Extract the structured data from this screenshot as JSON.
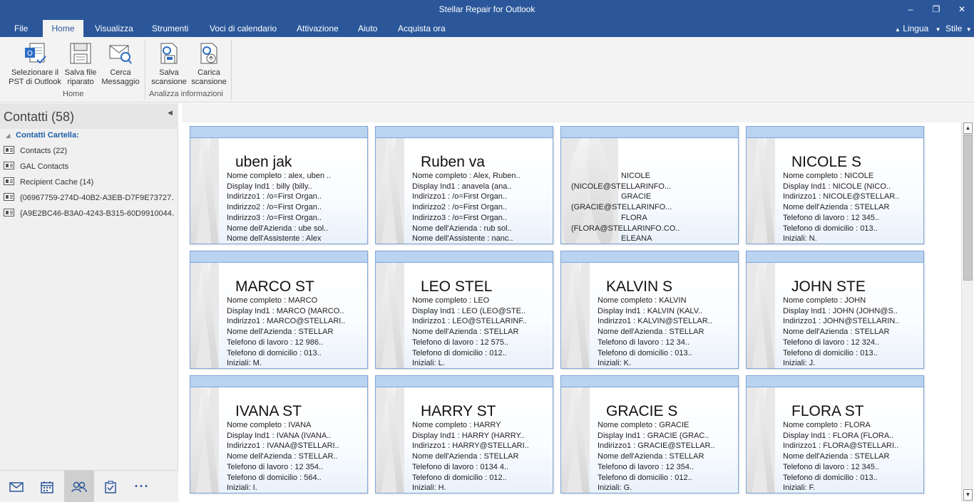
{
  "window": {
    "title": "Stellar Repair for Outlook",
    "controls": [
      "–",
      "❐",
      "✕"
    ]
  },
  "menu": {
    "tabs": [
      "File",
      "Home",
      "Visualizza",
      "Strumenti",
      "Voci di calendario",
      "Attivazione",
      "Aiuto",
      "Acquista ora"
    ],
    "active": "Home",
    "right": {
      "language": "Lingua",
      "style": "Stile"
    }
  },
  "ribbon": {
    "buttons": {
      "select_pst": "Selezionare il PST di Outlook",
      "save_repaired": "Salva file riparato",
      "find_message": "Cerca Messaggio",
      "save_scan": "Salva scansione",
      "load_scan": "Carica scansione"
    },
    "groups": {
      "home": "Home",
      "analyze": "Analizza informazioni"
    }
  },
  "sidebar": {
    "title": "Contatti (58)",
    "root_label": "Contatti Cartella:",
    "folders": [
      "Contacts (22)",
      "GAL Contacts",
      "Recipient Cache (14)",
      "{06967759-274D-40B2-A3EB-D7F9E73727…",
      "{A9E2BC46-B3A0-4243-B315-60D9910044…"
    ],
    "nav_icons": [
      "mail-icon",
      "calendar-icon",
      "contacts-icon",
      "tasks-icon",
      "more-icon"
    ]
  },
  "cards": [
    {
      "name": "uben jak",
      "fields": [
        "Nome completo : alex, uben ..",
        "Display Ind1 : billy (billy..",
        "Indirizzo1 : /o=First Organ..",
        "Indirizzo2 : /o=First Organ..",
        "Indirizzo3 : /o=First Organ..",
        "Nome dell'Azienda : ube sol..",
        "Nome dell'Assistente : Alex"
      ]
    },
    {
      "name": "Ruben va",
      "fields": [
        "Nome completo : Alex, Ruben..",
        "Display Ind1 : anavela (ana..",
        "Indirizzo1 : /o=First Organ..",
        "Indirizzo2 : /o=First Organ..",
        "Indirizzo3 : /o=First Organ..",
        "Nome dell'Azienda : rub sol..",
        "Nome dell'Assistente : nanc.."
      ]
    },
    {
      "name": "",
      "fields": [
        "NICOLE",
        "(NICOLE@STELLARINFO...",
        "GRACIE",
        "(GRACIE@STELLARINFO...",
        "FLORA",
        "(FLORA@STELLARINFO.CO..",
        "ELEANA"
      ]
    },
    {
      "name": "NICOLE S",
      "fields": [
        "Nome completo : NICOLE",
        "Display Ind1 : NICOLE (NICO..",
        "Indirizzo1 : NICOLE@STELLAR..",
        "Nome dell'Azienda : STELLAR",
        "Telefono di lavoro : 12 345..",
        "Telefono di domicilio : 013..",
        "Iniziali: N."
      ]
    },
    {
      "name": "MARCO ST",
      "fields": [
        "Nome completo : MARCO",
        "Display Ind1 : MARCO (MARCO..",
        "Indirizzo1 : MARCO@STELLARI..",
        "Nome dell'Azienda : STELLAR",
        "Telefono di lavoro : 12 986..",
        "Telefono di domicilio : 013..",
        "Iniziali: M."
      ]
    },
    {
      "name": "LEO STEL",
      "fields": [
        "Nome completo : LEO",
        "Display Ind1 : LEO (LEO@STE..",
        "Indirizzo1 : LEO@STELLARINF..",
        "Nome dell'Azienda : STELLAR",
        "Telefono di lavoro : 12 575..",
        "Telefono di domicilio : 012..",
        "Iniziali: L."
      ]
    },
    {
      "name": "KALVIN S",
      "fields": [
        "Nome completo : KALVIN",
        "Display Ind1 : KALVIN (KALV..",
        "Indirizzo1 : KALVIN@STELLAR..",
        "Nome dell'Azienda : STELLAR",
        "Telefono di lavoro : 12 34..",
        "Telefono di domicilio : 013..",
        "Iniziali: K."
      ]
    },
    {
      "name": "JOHN STE",
      "fields": [
        "Nome completo : JOHN",
        "Display Ind1 : JOHN (JOHN@S..",
        "Indirizzo1 : JOHN@STELLARIN..",
        "Nome dell'Azienda : STELLAR",
        "Telefono di lavoro : 12 324..",
        "Telefono di domicilio : 013..",
        "Iniziali: J."
      ]
    },
    {
      "name": "IVANA ST",
      "fields": [
        "Nome completo : IVANA",
        "Display Ind1 : IVANA (IVANA..",
        "Indirizzo1 : IVANA@STELLARI..",
        "Nome dell'Azienda : STELLAR..",
        "Telefono di lavoro : 12 354..",
        "Telefono di domicilio : 564..",
        "Iniziali: I."
      ]
    },
    {
      "name": "HARRY ST",
      "fields": [
        "Nome completo : HARRY",
        "Display Ind1 : HARRY (HARRY..",
        "Indirizzo1 : HARRY@STELLARI..",
        "Nome dell'Azienda : STELLAR",
        "Telefono di lavoro : 0134 4..",
        "Telefono di domicilio : 012..",
        "Iniziali: H."
      ]
    },
    {
      "name": "GRACIE S",
      "fields": [
        "Nome completo : GRACIE",
        "Display Ind1 : GRACIE (GRAC..",
        "Indirizzo1 : GRACIE@STELLAR..",
        "Nome dell'Azienda : STELLAR",
        "Telefono di lavoro : 12 354..",
        "Telefono di domicilio : 012..",
        "Iniziali: G."
      ]
    },
    {
      "name": "FLORA ST",
      "fields": [
        "Nome completo : FLORA",
        "Display Ind1 : FLORA (FLORA..",
        "Indirizzo1 : FLORA@STELLARI..",
        "Nome dell'Azienda : STELLAR",
        "Telefono di lavoro : 12 345..",
        "Telefono di domicilio : 013..",
        "Iniziali: F."
      ]
    }
  ]
}
